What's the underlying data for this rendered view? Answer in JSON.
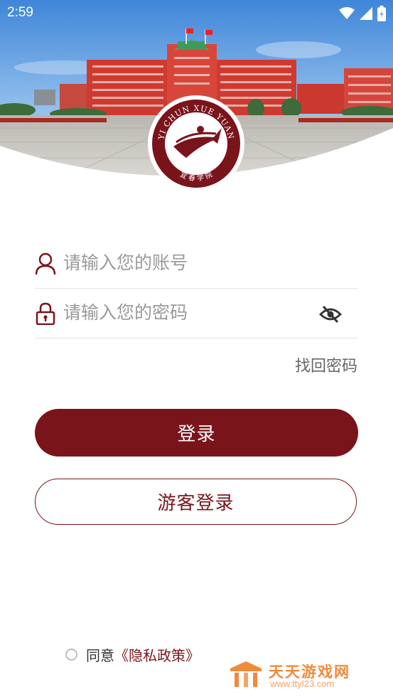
{
  "status_bar": {
    "time": "2:59"
  },
  "logo": {
    "top_text": "YI CHUN XUE YUAN",
    "bottom_text": "宜 春   学 院"
  },
  "login_form": {
    "account_placeholder": "请输入您的账号",
    "password_placeholder": "请输入您的密码",
    "forgot_password": "找回密码",
    "login_button": "登录",
    "guest_login_button": "游客登录"
  },
  "agreement": {
    "agree_text": "同意",
    "privacy_link": "《隐私政策》"
  },
  "watermark": {
    "title": "天天游戏网",
    "url": "www.ttyl23.com"
  },
  "colors": {
    "brand": "#7a141b",
    "placeholder": "#9a9a9a",
    "watermark": "#f08a3c"
  },
  "icons": [
    "user-icon",
    "lock-icon",
    "eye-off-icon",
    "wifi-icon",
    "signal-icon",
    "battery-icon"
  ]
}
